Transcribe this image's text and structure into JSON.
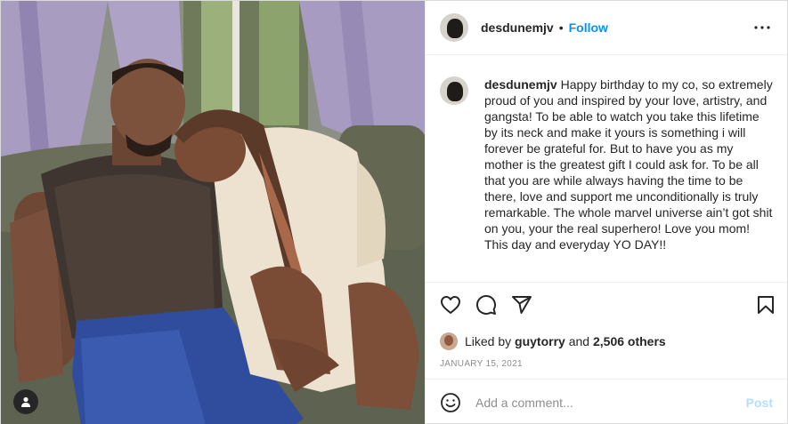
{
  "post": {
    "username": "desdunemjv",
    "follow_label": "Follow",
    "separator": "•",
    "caption": "Happy birthday to my co, so extremely proud of you and inspired by your love, artistry, and gangsta! To be able to watch you take this lifetime by its neck and make it yours is something i will forever be grateful for. But to have you as my mother is the greatest gift I could ask for. To be all that you are while always having the time to be there, love and support me unconditionally is truly remarkable. The whole marvel universe ain’t got shit on you, your the real superhero! Love you mom! This day and everyday YO DAY!!",
    "likes": {
      "prefix": "Liked by",
      "liker": "guytorry",
      "joiner": "and",
      "others": "2,506 others"
    },
    "date": "JANUARY 15, 2021"
  },
  "comment_box": {
    "placeholder": "Add a comment...",
    "post_label": "Post"
  },
  "icons": {
    "more": "more-options-icon",
    "like": "heart-icon",
    "comment": "comment-bubble-icon",
    "share": "share-paper-plane-icon",
    "save": "bookmark-icon",
    "emoji": "smiley-icon",
    "user_tag": "user-tag-icon"
  },
  "colors": {
    "link_blue": "#0095f6",
    "post_disabled": "#b2dffc",
    "muted_text": "#8e8e8e"
  }
}
